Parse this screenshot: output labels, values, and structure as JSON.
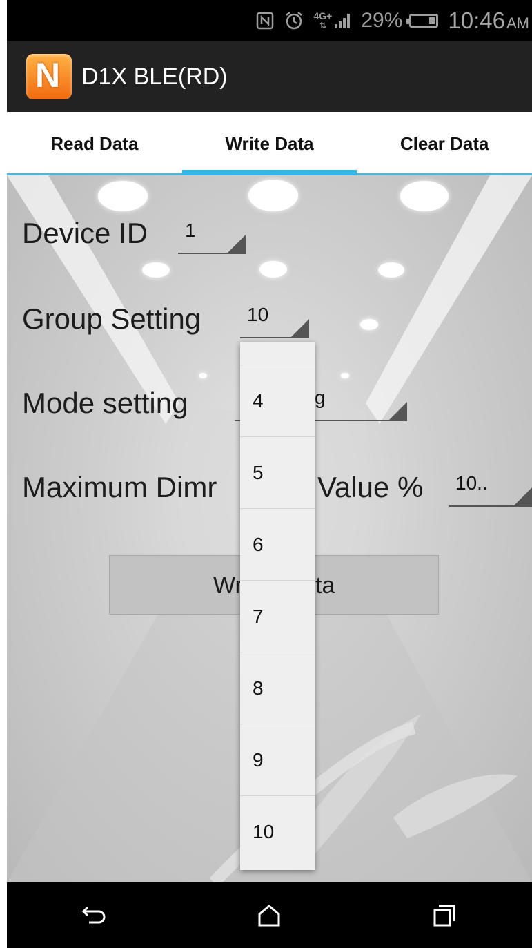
{
  "status_bar": {
    "icons": [
      "nfc-icon",
      "alarm-icon",
      "4g-icon",
      "signal-icon",
      "battery-icon"
    ],
    "network": "4G+",
    "battery": "29%",
    "time": "10:46",
    "ampm": "AM"
  },
  "app_bar": {
    "logo_letter": "N",
    "title": "D1X BLE(RD)",
    "accent": "#f57c00"
  },
  "tabs": [
    {
      "label": "Read Data",
      "active": false
    },
    {
      "label": "Write Data",
      "active": true
    },
    {
      "label": "Clear Data",
      "active": false
    }
  ],
  "tab_indicator_color": "#33b5e5",
  "form": {
    "device_id_label": "Device ID",
    "device_id_value": "1",
    "group_setting_label": "Group Setting",
    "group_setting_value": "10",
    "mode_setting_label": "Mode setting",
    "mode_setting_value_visible": "g",
    "max_dimming_label_left": "Maximum Dimr",
    "max_dimming_label_right": "Value %",
    "max_dimming_value": "10..",
    "write_button_left": "Wr",
    "write_button_right": "ta"
  },
  "dropdown": {
    "options": [
      "4",
      "5",
      "6",
      "7",
      "8",
      "9",
      "10"
    ]
  },
  "nav_bar": {
    "icons": [
      "back-icon",
      "home-icon",
      "recents-icon"
    ]
  }
}
